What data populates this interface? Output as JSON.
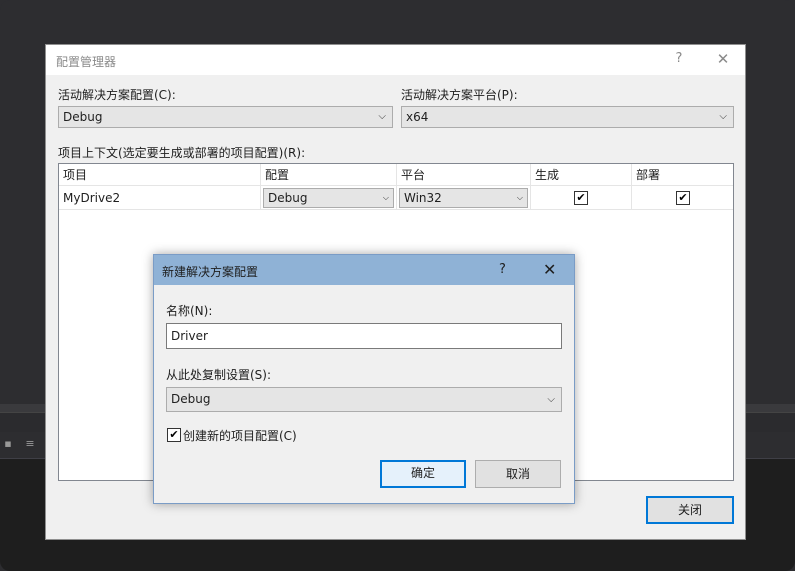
{
  "config_manager": {
    "title": "配置管理器",
    "help_glyph": "?",
    "close_glyph": "✕",
    "active_config_label": "活动解决方案配置(C):",
    "active_config_value": "Debug",
    "active_platform_label": "活动解决方案平台(P):",
    "active_platform_value": "x64",
    "context_label": "项目上下文(选定要生成或部署的项目配置)(R):",
    "columns": [
      "项目",
      "配置",
      "平台",
      "生成",
      "部署"
    ],
    "rows": [
      {
        "project": "MyDrive2",
        "config": "Debug",
        "platform": "Win32",
        "build": true,
        "deploy": true
      }
    ],
    "close_button": "关闭"
  },
  "new_config_dialog": {
    "title": "新建解决方案配置",
    "help_glyph": "?",
    "close_glyph": "✕",
    "name_label": "名称(N):",
    "name_value": "Driver",
    "copy_from_label": "从此处复制设置(S):",
    "copy_from_value": "Debug",
    "create_project_configs_label": "创建新的项目配置(C)",
    "create_project_configs_checked": true,
    "ok_button": "确定",
    "cancel_button": "取消"
  },
  "glyphs": {
    "dropdown": "⌵",
    "check": "✔"
  }
}
